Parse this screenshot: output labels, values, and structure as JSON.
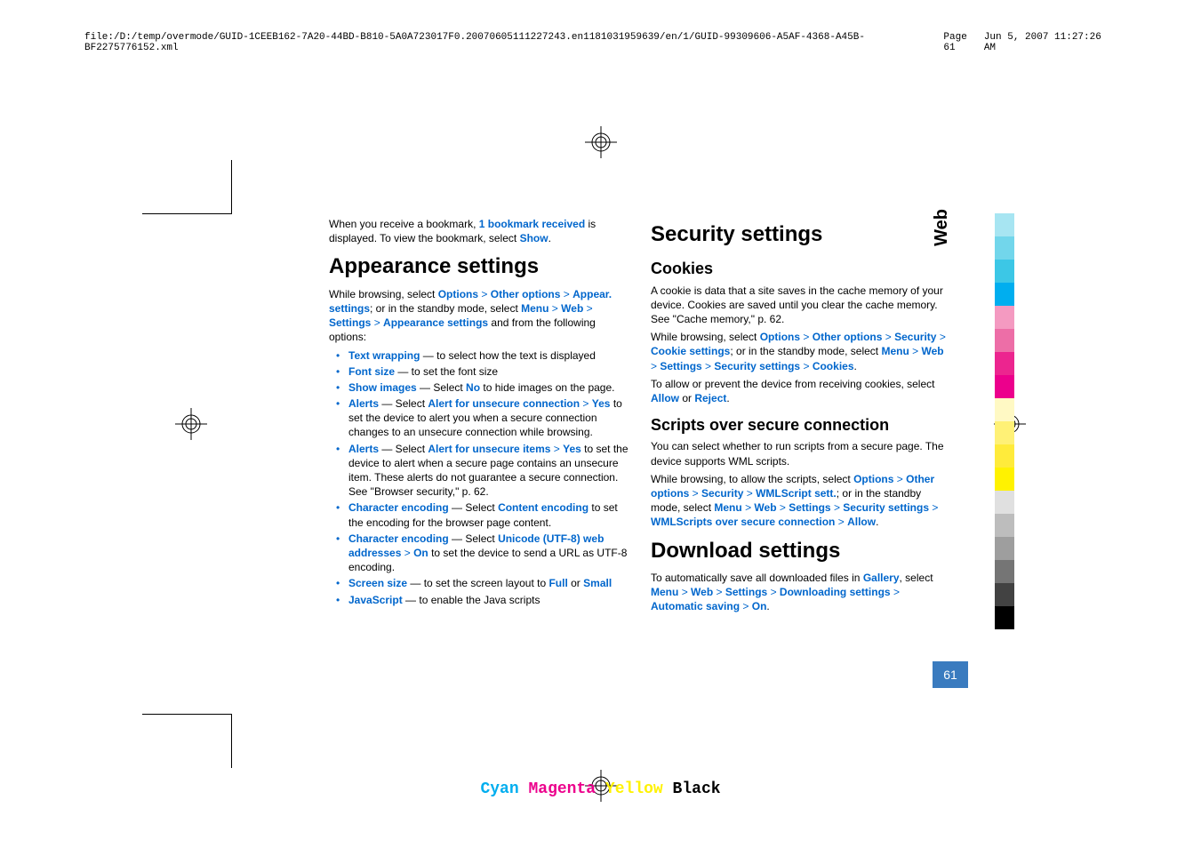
{
  "header": {
    "path": "file:/D:/temp/overmode/GUID-1CEEB162-7A20-44BD-B810-5A0A723017F0.20070605111227243.en1181031959639/en/1/GUID-99309606-A5AF-4368-A45B-BF2275776152.xml",
    "page": "Page 61",
    "timestamp": "Jun 5, 2007 11:27:26 AM"
  },
  "side": {
    "tab": "Web",
    "page_num": "61"
  },
  "col1": {
    "intro_a": "When you receive a bookmark, ",
    "intro_b": "1 bookmark received",
    "intro_c": " is displayed. To view the bookmark, select ",
    "intro_d": "Show",
    "intro_e": ".",
    "h1": "Appearance settings",
    "p1a": "While browsing, select ",
    "options": "Options",
    "other_options": "Other options",
    "appear_settings": "Appear. settings",
    "p1b": "; or in the standby mode, select ",
    "menu": "Menu",
    "web": "Web",
    "settings": "Settings",
    "appearance_settings": "Appearance settings",
    "p1c": " and from the following options:",
    "li1a": "Text wrapping",
    "li1b": " — to select how the text is displayed",
    "li2a": "Font size",
    "li2b": " — to set the font size",
    "li3a": "Show images",
    "li3b": " — Select ",
    "no": "No",
    "li3c": " to hide images on the page.",
    "li4a": "Alerts",
    "li4b": " — Select ",
    "li4c": "Alert for unsecure connection",
    "yes": "Yes",
    "li4d": " to set the device to alert you when a secure connection changes to an unsecure connection while browsing.",
    "li5a": "Alerts",
    "li5b": " — Select ",
    "li5c": "Alert for unsecure items",
    "li5d": " to set the device to alert when a secure page contains an unsecure item. These alerts do not guarantee a secure connection. See \"Browser security,\" p. 62.",
    "li6a": "Character encoding",
    "li6b": " — Select ",
    "li6c": "Content encoding",
    "li6d": " to set the encoding for the browser page content.",
    "li7a": "Character encoding",
    "li7b": " — Select ",
    "li7c": "Unicode (UTF-8) web addresses",
    "on": "On",
    "li7d": " to set the device to send a URL as UTF-8 encoding.",
    "li8a": "Screen size",
    "li8b": " — to set the screen layout to ",
    "full": "Full",
    "or": " or ",
    "small": "Small",
    "li9a": "JavaScript",
    "li9b": " — to enable the Java scripts"
  },
  "col2": {
    "h1a": "Security settings",
    "h2a": "Cookies",
    "p1": "A cookie is data that a site saves in the cache memory of your device. Cookies are saved until you clear the cache memory. See \"Cache memory,\" p. 62.",
    "p2a": "While browsing, select ",
    "options": "Options",
    "other_options": "Other options",
    "security": "Security",
    "cookie_settings": "Cookie settings",
    "p2b": "; or in the standby mode, select ",
    "menu": "Menu",
    "web": "Web",
    "settings": "Settings",
    "security_settings": "Security settings",
    "cookies": "Cookies",
    "dot": ".",
    "p3a": "To allow or prevent the device from receiving cookies, select ",
    "allow": "Allow",
    "or": " or ",
    "reject": "Reject",
    "h2b": "Scripts over secure connection",
    "p4": "You can select whether to run scripts from a secure page. The device supports WML scripts.",
    "p5a": "While browsing, to allow the scripts, select ",
    "wml_sett": "WMLScript sett.",
    "p5b": "; or in the standby mode, select ",
    "wml_conn": "WMLScripts over secure connection",
    "allow2": "Allow",
    "h1b": "Download settings",
    "p6a": "To automatically save all downloaded files in ",
    "gallery": "Gallery",
    "p6b": ", select ",
    "dl_settings": "Downloading settings",
    "auto_save": "Automatic saving",
    "on": "On"
  },
  "footer": {
    "c": "Cyan",
    "m": "Magenta",
    "y": "Yellow",
    "k": "Black"
  },
  "bars": [
    "#a7e5f2",
    "#72d6eb",
    "#3cc7e6",
    "#00aeef",
    "#f49ac1",
    "#ed6ea7",
    "#ec258f",
    "#ec008c",
    "#fff9c4",
    "#fff176",
    "#ffeb3b",
    "#fff200",
    "#e0e0e0",
    "#bdbdbd",
    "#9e9e9e",
    "#757575",
    "#424242",
    "#000000"
  ]
}
